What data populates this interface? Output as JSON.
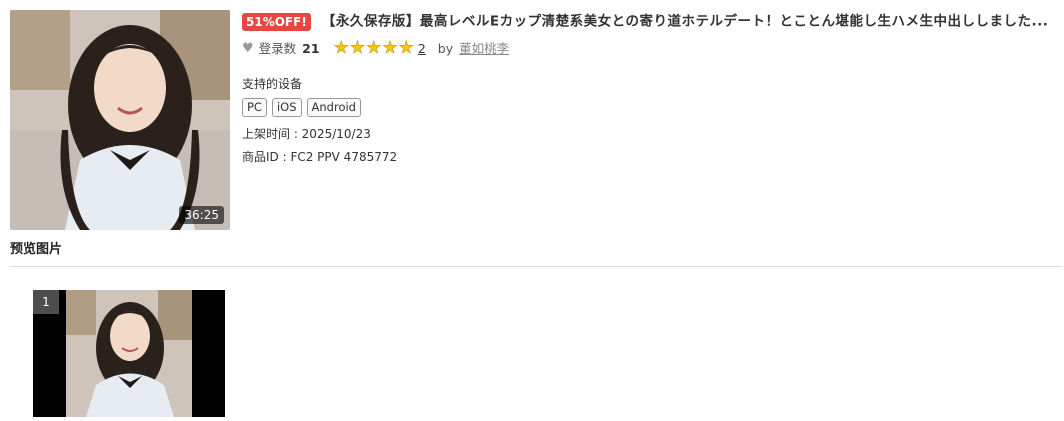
{
  "product": {
    "duration": "36:25",
    "discount_badge": "51%OFF!",
    "title": "【永久保存版】最高レベルEカップ清楚系美女との寄り道ホテルデート！とことん堪能し生ハメ生中出ししました...",
    "favorites_label": "登录数",
    "favorites_count": "21",
    "rating_stars": 5,
    "rating_count": "2",
    "by_label": "by",
    "author": "董如桃李",
    "devices_label": "支持的设备",
    "devices": [
      "PC",
      "iOS",
      "Android"
    ],
    "release_label": "上架时间 : 2025/10/23",
    "product_id_label": "商品ID : FC2 PPV 4785772"
  },
  "preview": {
    "heading": "预览图片",
    "items": [
      {
        "index": "1"
      }
    ]
  },
  "colors": {
    "badge": "#e8473f",
    "star": "#f5c518",
    "divider": "#dddddd"
  }
}
